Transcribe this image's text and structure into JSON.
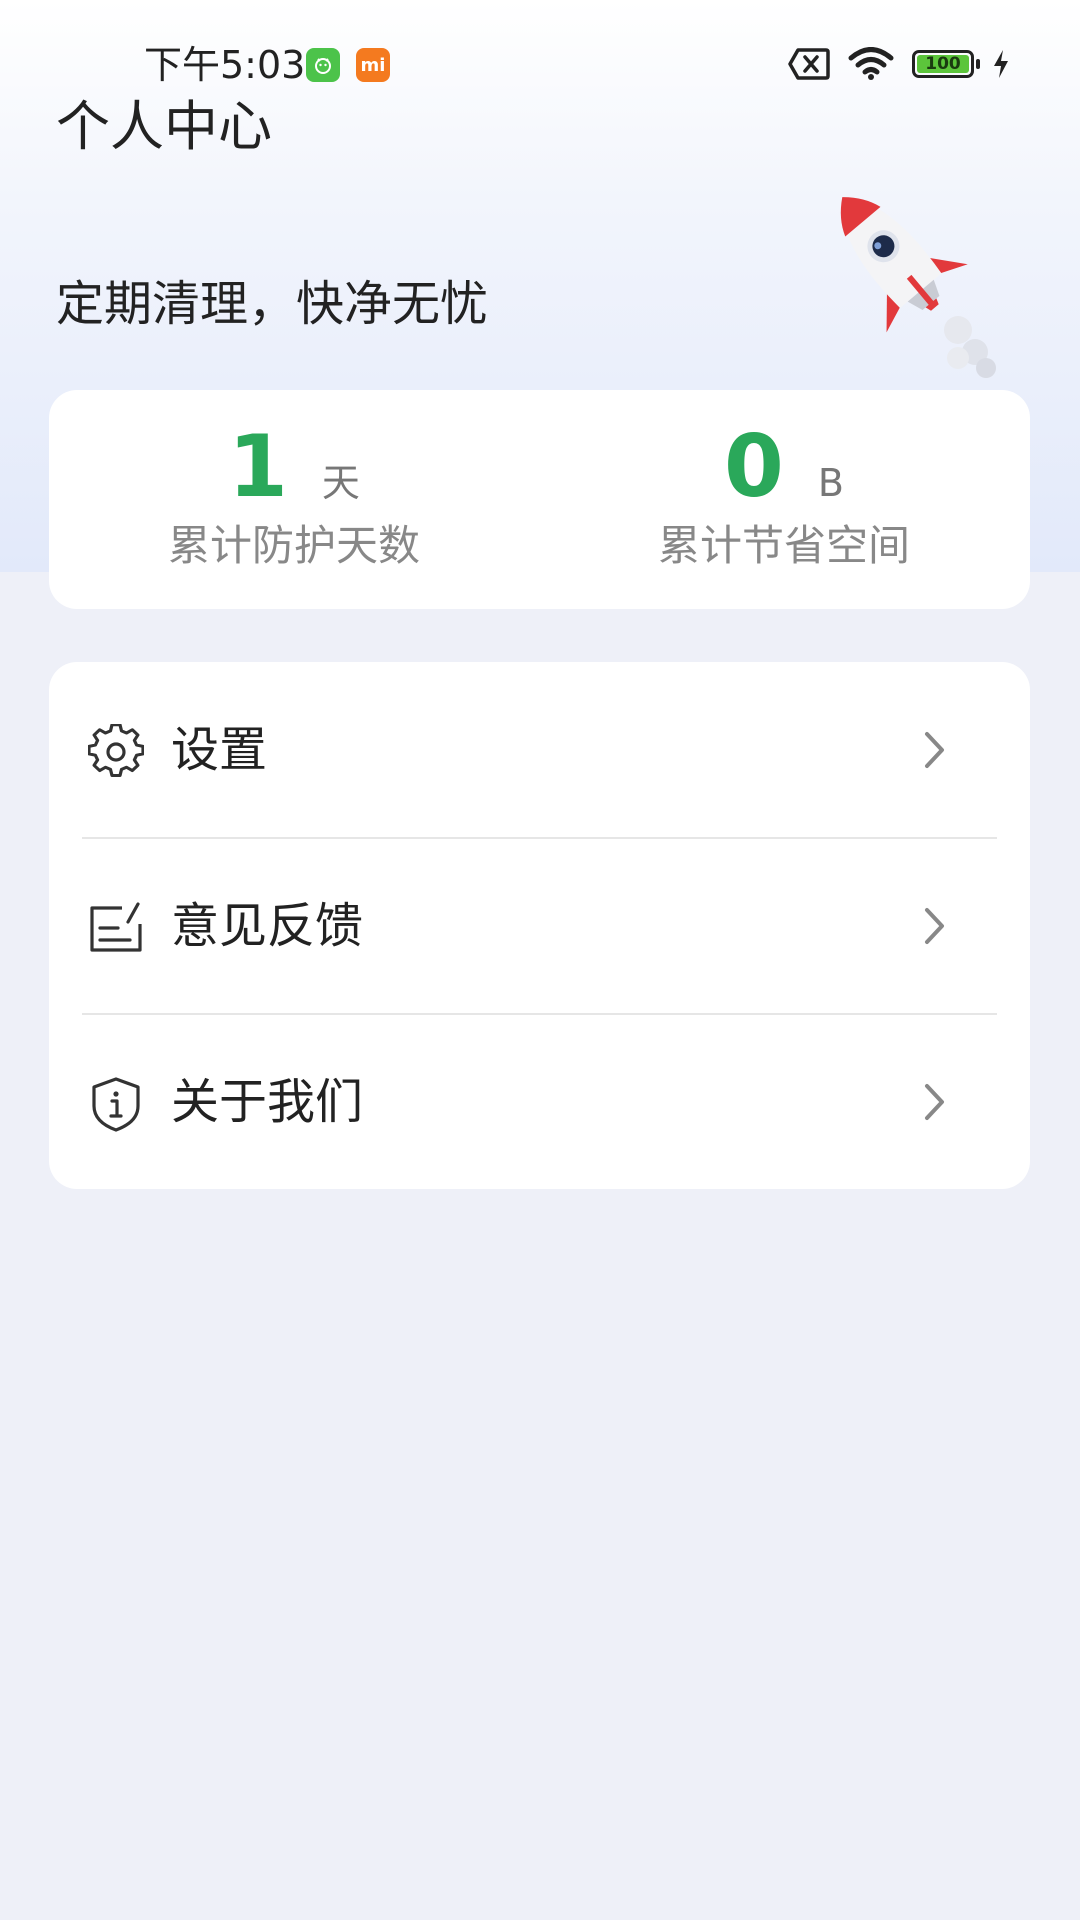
{
  "status_bar": {
    "time": "下午5:03",
    "battery_level": "100",
    "notification_icons": [
      "app-notification-icon",
      "mi-notification-icon"
    ],
    "notif_mi_text": "mi"
  },
  "header": {
    "title": "个人中心",
    "slogan": "定期清理，快净无忧"
  },
  "stats": {
    "protection_days": {
      "value": "1",
      "unit": "天",
      "label": "累计防护天数"
    },
    "space_saved": {
      "value": "0",
      "unit": "B",
      "label": "累计节省空间"
    }
  },
  "menu": {
    "items": [
      {
        "label": "设置",
        "icon": "gear-icon"
      },
      {
        "label": "意见反馈",
        "icon": "feedback-icon"
      },
      {
        "label": "关于我们",
        "icon": "info-shield-icon"
      }
    ]
  },
  "colors": {
    "accent_green": "#2aa85a",
    "background": "#eef0f8",
    "card": "#ffffff"
  }
}
